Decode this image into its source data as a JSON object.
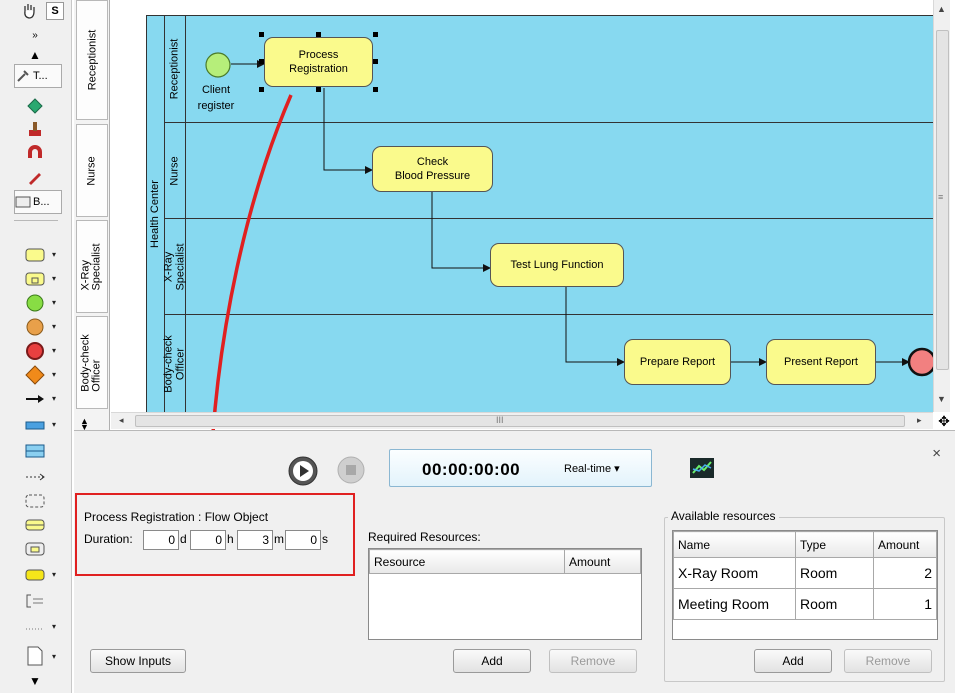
{
  "palette": {
    "tools": [
      {
        "name": "hand-tool-icon"
      },
      {
        "name": "select-tool-icon",
        "label": "S"
      },
      {
        "name": "collapse-icon"
      },
      {
        "name": "scroll-up-icon"
      },
      {
        "name": "tools-menu",
        "label": "T..."
      },
      {
        "name": "eraser-icon"
      },
      {
        "name": "format-copier-icon"
      },
      {
        "name": "magnet-icon"
      },
      {
        "name": "pen-icon"
      },
      {
        "name": "bpmn-menu",
        "label": "B..."
      }
    ]
  },
  "lanes": [
    {
      "id": "receptionist",
      "label": "Receptionist"
    },
    {
      "id": "nurse",
      "label": "Nurse"
    },
    {
      "id": "xray",
      "label": "X-Ray\nSpecialist"
    },
    {
      "id": "bodycheck",
      "label": "Body-check\nOfficer"
    }
  ],
  "pool": {
    "label": "Health Center"
  },
  "diagram": {
    "start_event_label": "Client\nregister",
    "tasks": [
      {
        "id": "process-registration",
        "label": "Process\nRegistration"
      },
      {
        "id": "check-blood-pressure",
        "label": "Check\nBlood Pressure"
      },
      {
        "id": "test-lung-function",
        "label": "Test Lung Function"
      },
      {
        "id": "prepare-report",
        "label": "Prepare Report"
      },
      {
        "id": "present-report",
        "label": "Present Report"
      }
    ],
    "hscroll_grip": "III"
  },
  "colors": {
    "pool": "#87d9f0",
    "task": "#fafa8c",
    "start_event": "#b6ee7a",
    "end_event": "#f28080",
    "highlight": "#e02020"
  },
  "sim": {
    "timer": "00:00:00:00",
    "mode": "Real-time ▾",
    "close": "×",
    "flow_object_title": "Process Registration : Flow Object",
    "duration_label": "Duration:",
    "duration": [
      {
        "value": "0",
        "unit": "d"
      },
      {
        "value": "0",
        "unit": "h"
      },
      {
        "value": "3",
        "unit": "m"
      },
      {
        "value": "0",
        "unit": "s"
      }
    ],
    "required_title": "Required Resources:",
    "required_columns": [
      "Resource",
      "Amount"
    ],
    "required_add": "Add",
    "required_remove": "Remove",
    "show_inputs": "Show Inputs",
    "available_title": "Available resources",
    "available_columns": [
      "Name",
      "Type",
      "Amount"
    ],
    "available_rows": [
      {
        "name": "X-Ray Room",
        "type": "Room",
        "amount": "2"
      },
      {
        "name": "Meeting Room",
        "type": "Room",
        "amount": "1"
      }
    ],
    "available_add": "Add",
    "available_remove": "Remove"
  }
}
